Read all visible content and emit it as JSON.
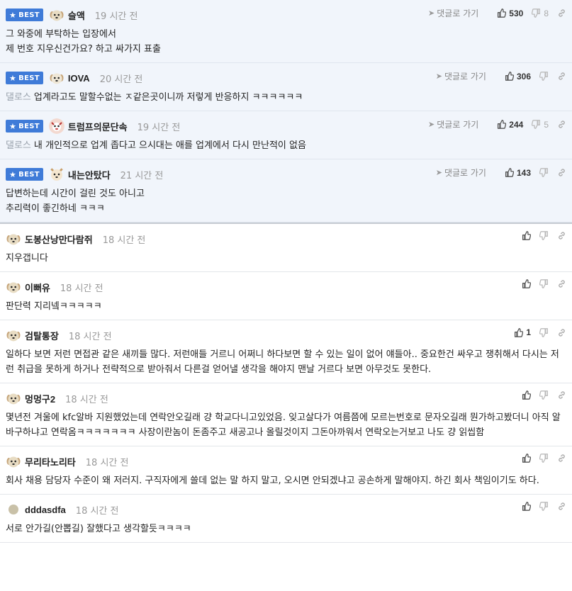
{
  "best_badge_label": "BEST",
  "goto_label": "댓글로 가기",
  "best_comments": [
    {
      "nick": "슬액",
      "time": "19 시간 전",
      "reply_to": "",
      "text": "그 와중에 부탁하는 입장에서\n제 번호 지우신건가요? 하고 싸가지 표출",
      "likes": "530",
      "dislikes": "8",
      "avatar": "dog"
    },
    {
      "nick": "IOVA",
      "time": "20 시간 전",
      "reply_to": "댈로스",
      "text": "업계라고도 말할수없는 ㅈ같은곳이니까 저렇게 반응하지 ㅋㅋㅋㅋㅋㅋ",
      "likes": "306",
      "dislikes": "",
      "avatar": "dog-pale"
    },
    {
      "nick": "트럼프의문단속",
      "time": "19 시간 전",
      "reply_to": "댈로스",
      "text": "내 개인적으로 업계 좁다고 으시대는 애를 업계에서 다시 만난적이 없음",
      "likes": "244",
      "dislikes": "5",
      "avatar": "face"
    },
    {
      "nick": "내는안탔다",
      "time": "21 시간 전",
      "reply_to": "",
      "text": "답변하는데 시간이 걸린 것도 아니고\n추리력이 좋긴하네 ㅋㅋㅋ",
      "likes": "143",
      "dislikes": "",
      "avatar": "fox"
    }
  ],
  "comments": [
    {
      "nick": "도봉산낭만다람쥐",
      "time": "18 시간 전",
      "text": "지우갭니다",
      "likes": "",
      "avatar": "dog"
    },
    {
      "nick": "이뻐유",
      "time": "18 시간 전",
      "text": "판단력 지리넼ㅋㅋㅋㅋㅋ",
      "likes": "",
      "avatar": "dog"
    },
    {
      "nick": "검탈통장",
      "time": "18 시간 전",
      "text": "일하다 보면 저런 면접관 같은 새끼들 많다. 저런애들 거르니 어쩌니 하다보면 할 수 있는 일이 없어 얘들아.. 중요한건 싸우고 쟁취해서 다시는 저런 취급을 못하게 하거나 전략적으로 받아줘서 다른걸 얻어낼 생각을 해야지 맨날 거르다 보면 아무것도 못한다.",
      "likes": "1",
      "avatar": "dog"
    },
    {
      "nick": "멍멍구2",
      "time": "18 시간 전",
      "text": "몇년전 겨울에 kfc알바 지원했었는데 연락안오길래 걍 학교다니고있었음. 잊고살다가 여름쯤에 모르는번호로 문자오길래 뭔가하고봤더니 아직 알바구하냐고 연락옴ㅋㅋㅋㅋㅋㅋㅋ 사장이란놈이 돈좀주고 새공고나 올릴것이지 그돈아까워서 연락오는거보고 나도 걍 읽씹함",
      "likes": "",
      "avatar": "dog"
    },
    {
      "nick": "무리타노리타",
      "time": "18 시간 전",
      "text": "회사 채용 담당자 수준이 왜 저러지. 구직자에게 쓸데 없는 말 하지 말고, 오시면 안되겠냐고 공손하게 말해야지. 하긴 회사 책임이기도 하다.",
      "likes": "",
      "avatar": "dog"
    },
    {
      "nick": "dddasdfa",
      "time": "18 시간 전",
      "text": "서로 안가길(안뽑길) 잘했다고 생각할듯ㅋㅋㅋㅋ",
      "likes": "",
      "avatar": "dot"
    }
  ],
  "colors": {
    "badge": "#3f7bd8",
    "best_bg": "#f1f5fb",
    "muted": "#999999"
  }
}
